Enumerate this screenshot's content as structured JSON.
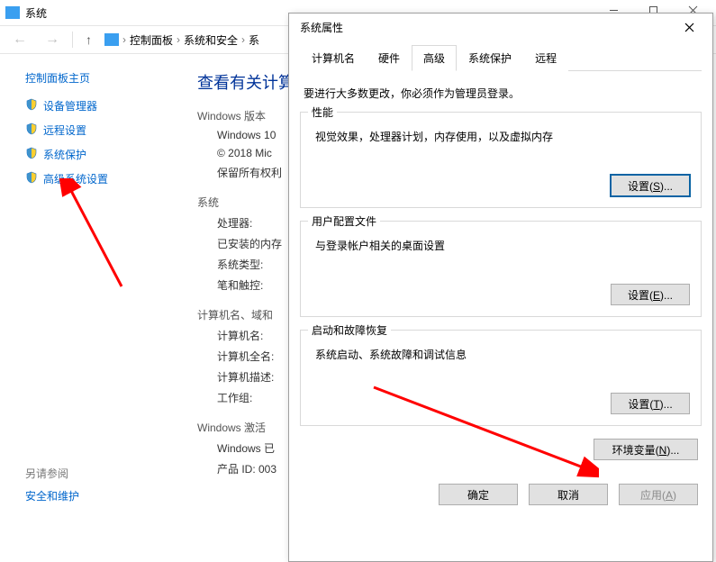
{
  "back": {
    "title": "系统",
    "breadcrumb": {
      "item1": "控制面板",
      "item2": "系统和安全",
      "item3": "系"
    },
    "sidebar": {
      "home": "控制面板主页",
      "items": [
        {
          "label": "设备管理器"
        },
        {
          "label": "远程设置"
        },
        {
          "label": "系统保护"
        },
        {
          "label": "高级系统设置"
        }
      ],
      "see_also_title": "另请参阅",
      "see_also_link": "安全和维护"
    },
    "main": {
      "heading": "查看有关计算",
      "os_section": "Windows 版本",
      "os_name": "Windows 10",
      "copyright1": "© 2018 Mic",
      "copyright2": "保留所有权利",
      "system_section": "系统",
      "cpu": "处理器:",
      "ram": "已安装的内存",
      "systype": "系统类型:",
      "pen": "笔和触控:",
      "name_section": "计算机名、域和",
      "cn": "计算机名:",
      "cfn": "计算机全名:",
      "cd": "计算机描述:",
      "wg": "工作组:",
      "act_section": "Windows 激活",
      "act_status": "Windows 已",
      "pid": "产品 ID: 003"
    }
  },
  "dialog": {
    "title": "系统属性",
    "tabs": [
      {
        "label": "计算机名"
      },
      {
        "label": "硬件"
      },
      {
        "label": "高级"
      },
      {
        "label": "系统保护"
      },
      {
        "label": "远程"
      }
    ],
    "active_tab": 2,
    "admin_note": "要进行大多数更改，你必须作为管理员登录。",
    "perf": {
      "legend": "性能",
      "desc": "视觉效果，处理器计划，内存使用，以及虚拟内存",
      "btn": "设置(S)..."
    },
    "profile": {
      "legend": "用户配置文件",
      "desc": "与登录帐户相关的桌面设置",
      "btn": "设置(E)..."
    },
    "startup": {
      "legend": "启动和故障恢复",
      "desc": "系统启动、系统故障和调试信息",
      "btn": "设置(T)..."
    },
    "env_btn": "环境变量(N)...",
    "footer": {
      "ok": "确定",
      "cancel": "取消",
      "apply": "应用(A)"
    }
  }
}
